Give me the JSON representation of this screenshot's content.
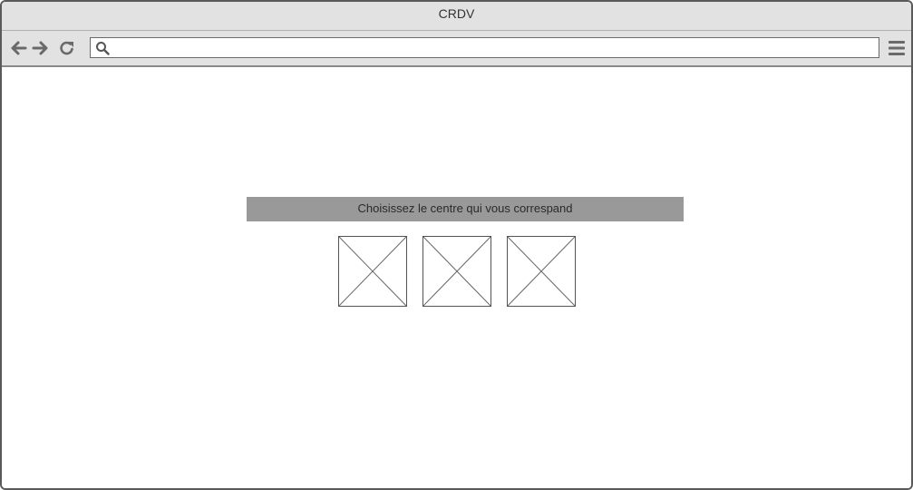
{
  "window": {
    "title": "CRDV"
  },
  "toolbar": {
    "back_icon": "arrow-left-icon",
    "forward_icon": "arrow-right-icon",
    "reload_icon": "reload-icon",
    "menu_icon": "hamburger-menu-icon",
    "address": {
      "value": "",
      "search_icon": "search-icon"
    }
  },
  "main": {
    "banner_text": "Choisissez le centre qui vous correspand",
    "centre_options": [
      {
        "icon": "image-placeholder-icon"
      },
      {
        "icon": "image-placeholder-icon"
      },
      {
        "icon": "image-placeholder-icon"
      }
    ]
  },
  "colors": {
    "chrome": "#e2e2e2",
    "banner": "#999999",
    "border": "#5a5a5a"
  }
}
